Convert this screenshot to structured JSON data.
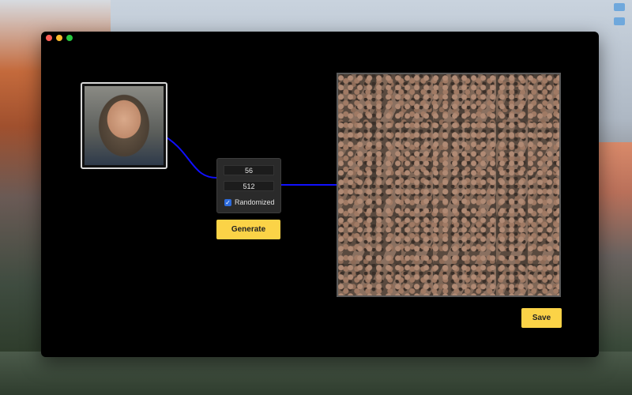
{
  "window": {
    "controls": [
      "close",
      "minimize",
      "zoom"
    ]
  },
  "input_image": {
    "icon": "portrait-image"
  },
  "panel": {
    "seed_value": "56",
    "size_value": "512",
    "randomized_label": "Randomized",
    "randomized_checked": true
  },
  "buttons": {
    "generate_label": "Generate",
    "save_label": "Save"
  },
  "output_image": {
    "icon": "generated-texture-image"
  },
  "colors": {
    "accent_button": "#fbd347",
    "wire": "#1010ff",
    "checkbox": "#2d6bdd"
  }
}
